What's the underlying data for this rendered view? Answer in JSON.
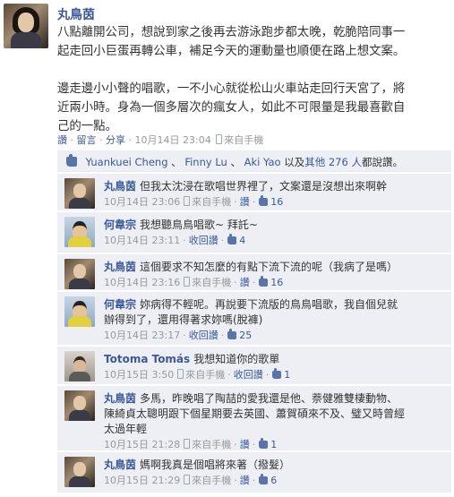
{
  "post": {
    "author": "丸鳥茵",
    "paragraphs": [
      [
        "八點離開公司，想說到家之後再去游泳跑步都太晚，乾脆陪同事一",
        "起走回小巨蛋再轉公車，補足今天的運動量也順便在路上想文案。"
      ],
      [
        "邊走邊小小聲的唱歌，一不小心就從松山火車站走回行天宮了，將",
        "近兩小時。身為一個多層次的瘋女人，如此不可限量是我最喜歡自",
        "己的一點。"
      ]
    ],
    "meta": {
      "like": "讚",
      "comment": "留言",
      "share": "分享",
      "time": "10月14日 23:04",
      "via": "來自手機",
      "sep": "·"
    }
  },
  "likes": {
    "names": [
      "Yuankuei Cheng",
      "Finny Lu",
      "Aki Yao"
    ],
    "sep": "、",
    "others": "以及",
    "others_link": "其他 276 人",
    "suffix": "都說讚。"
  },
  "comments": [
    {
      "name": "丸鳥茵",
      "avatar": "owner",
      "lines": [
        "但我太沈浸在歌唱世界裡了，文案還是沒想出來啊幹"
      ],
      "time": "10月14日 23:06",
      "via": "來自手機",
      "action": "讚",
      "likes": "16"
    },
    {
      "name": "何韋宗",
      "avatar": "he",
      "lines": [
        "我想聽鳥鳥唱歌~ 拜託~"
      ],
      "time": "10月14日 23:11",
      "via": "",
      "action": "收回讚",
      "likes": "4"
    },
    {
      "name": "丸鳥茵",
      "avatar": "owner",
      "lines": [
        "這個要求不知怎麼的有點下流下流的呢（我病了是嗎）"
      ],
      "time": "10月14日 23:16",
      "via": "來自手機",
      "action": "讚",
      "likes": "16"
    },
    {
      "name": "何韋宗",
      "avatar": "he",
      "lines": [
        "妳病得不輕呢。再說要下流版的鳥鳥唱歌，我自個兒就",
        "辦得到了，還用得著求妳嗎(脫褲)"
      ],
      "time": "10月14日 23:17",
      "via": "",
      "action": "收回讚",
      "likes": "25"
    },
    {
      "name": "Totoma Tomás",
      "avatar": "to",
      "lines": [
        "我想知道你的歌單"
      ],
      "time": "10月15日 3:50",
      "via": "來自手機",
      "action": "收回讚",
      "likes": "1"
    },
    {
      "name": "丸鳥茵",
      "avatar": "owner",
      "lines": [
        "多馬，昨晚唱了陶喆的愛我還是他、萘健雅雙棲動物、",
        "陳綺貞太聰明跟下個星期要去英國、蕭賀碩來不及、璧又時曾經",
        "太過年輕"
      ],
      "time": "10月15日 21:28",
      "via": "來自手機",
      "action": "讚",
      "likes": "1"
    },
    {
      "name": "丸鳥茵",
      "avatar": "owner",
      "lines": [
        "媽啊我真是個唱將來著（撥髮）"
      ],
      "time": "10月15日 21:29",
      "via": "來自手機",
      "action": "讚",
      "likes": "6"
    }
  ]
}
